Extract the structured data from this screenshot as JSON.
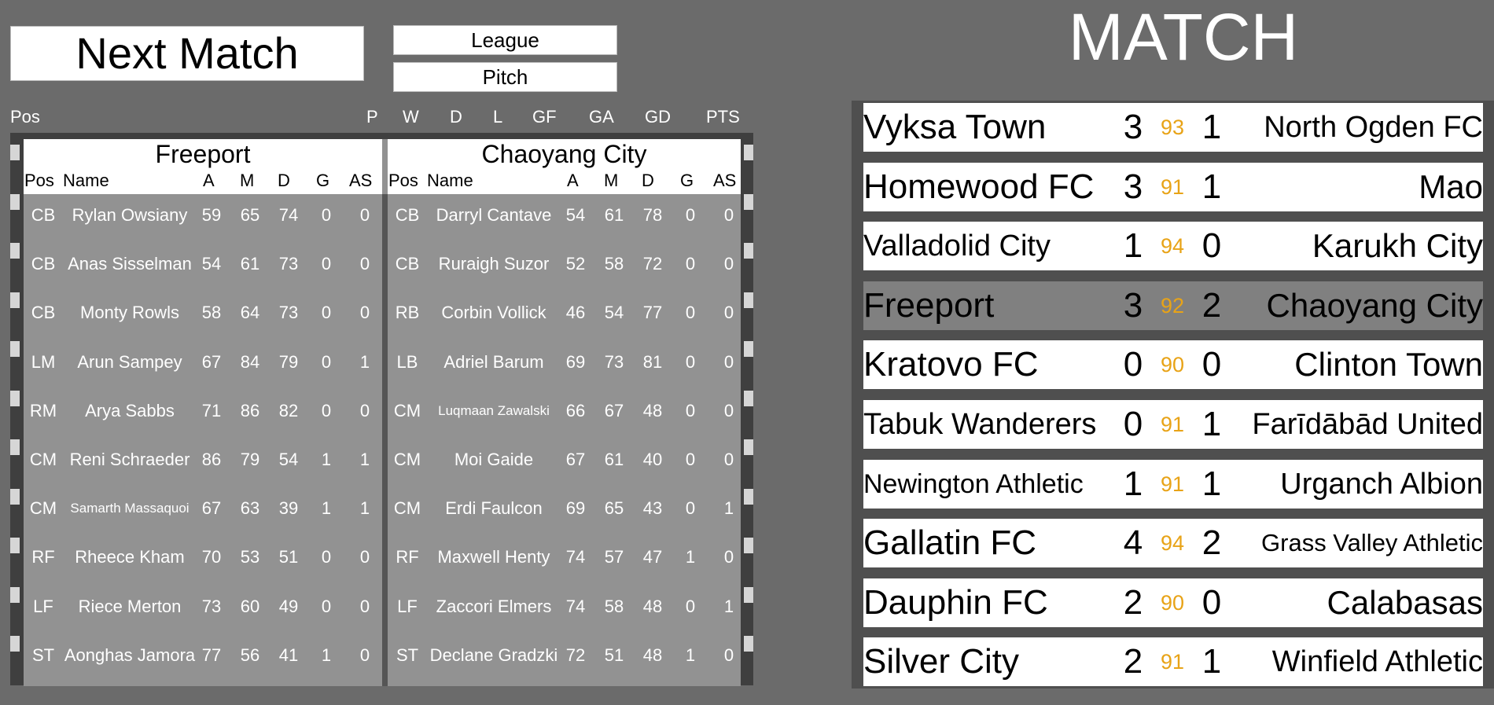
{
  "header": {
    "next_match": "Next Match",
    "league": "League",
    "pitch": "Pitch",
    "match_title": "MATCH"
  },
  "league_columns": [
    "Pos",
    "P",
    "W",
    "D",
    "L",
    "GF",
    "GA",
    "GD",
    "PTS"
  ],
  "lineups": {
    "columns": [
      "Pos",
      "Name",
      "A",
      "M",
      "D",
      "G",
      "AS"
    ],
    "home": {
      "team": "Freeport",
      "players": [
        {
          "pos": "CB",
          "name": "Rylan Owsiany",
          "a": "59",
          "m": "65",
          "d": "74",
          "g": "0",
          "as": "0"
        },
        {
          "pos": "CB",
          "name": "Anas Sisselman",
          "a": "54",
          "m": "61",
          "d": "73",
          "g": "0",
          "as": "0"
        },
        {
          "pos": "CB",
          "name": "Monty Rowls",
          "a": "58",
          "m": "64",
          "d": "73",
          "g": "0",
          "as": "0"
        },
        {
          "pos": "LM",
          "name": "Arun Sampey",
          "a": "67",
          "m": "84",
          "d": "79",
          "g": "0",
          "as": "1"
        },
        {
          "pos": "RM",
          "name": "Arya Sabbs",
          "a": "71",
          "m": "86",
          "d": "82",
          "g": "0",
          "as": "0"
        },
        {
          "pos": "CM",
          "name": "Reni Schraeder",
          "a": "86",
          "m": "79",
          "d": "54",
          "g": "1",
          "as": "1"
        },
        {
          "pos": "CM",
          "name": "Samarth Massaquoi",
          "a": "67",
          "m": "63",
          "d": "39",
          "g": "1",
          "as": "1"
        },
        {
          "pos": "RF",
          "name": "Rheece Kham",
          "a": "70",
          "m": "53",
          "d": "51",
          "g": "0",
          "as": "0"
        },
        {
          "pos": "LF",
          "name": "Riece Merton",
          "a": "73",
          "m": "60",
          "d": "49",
          "g": "0",
          "as": "0"
        },
        {
          "pos": "ST",
          "name": "Aonghas Jamora",
          "a": "77",
          "m": "56",
          "d": "41",
          "g": "1",
          "as": "0"
        }
      ]
    },
    "away": {
      "team": "Chaoyang City",
      "players": [
        {
          "pos": "CB",
          "name": "Darryl Cantave",
          "a": "54",
          "m": "61",
          "d": "78",
          "g": "0",
          "as": "0"
        },
        {
          "pos": "CB",
          "name": "Ruraigh Suzor",
          "a": "52",
          "m": "58",
          "d": "72",
          "g": "0",
          "as": "0"
        },
        {
          "pos": "RB",
          "name": "Corbin Vollick",
          "a": "46",
          "m": "54",
          "d": "77",
          "g": "0",
          "as": "0"
        },
        {
          "pos": "LB",
          "name": "Adriel Barum",
          "a": "69",
          "m": "73",
          "d": "81",
          "g": "0",
          "as": "0"
        },
        {
          "pos": "CM",
          "name": "Luqmaan Zawalski",
          "a": "66",
          "m": "67",
          "d": "48",
          "g": "0",
          "as": "0"
        },
        {
          "pos": "CM",
          "name": "Moi Gaide",
          "a": "67",
          "m": "61",
          "d": "40",
          "g": "0",
          "as": "0"
        },
        {
          "pos": "CM",
          "name": "Erdi Faulcon",
          "a": "69",
          "m": "65",
          "d": "43",
          "g": "0",
          "as": "1"
        },
        {
          "pos": "RF",
          "name": "Maxwell Henty",
          "a": "74",
          "m": "57",
          "d": "47",
          "g": "1",
          "as": "0"
        },
        {
          "pos": "LF",
          "name": "Zaccori Elmers",
          "a": "74",
          "m": "58",
          "d": "48",
          "g": "0",
          "as": "1"
        },
        {
          "pos": "ST",
          "name": "Declane Gradzki",
          "a": "72",
          "m": "51",
          "d": "48",
          "g": "1",
          "as": "0"
        }
      ]
    }
  },
  "fixtures": [
    {
      "home": "Vyksa Town",
      "home_score": "3",
      "minute": "93",
      "away_score": "1",
      "away": "North Ogden FC",
      "active": false
    },
    {
      "home": "Homewood FC",
      "home_score": "3",
      "minute": "91",
      "away_score": "1",
      "away": "Mao",
      "active": false
    },
    {
      "home": "Valladolid City",
      "home_score": "1",
      "minute": "94",
      "away_score": "0",
      "away": "Karukh City",
      "active": false
    },
    {
      "home": "Freeport",
      "home_score": "3",
      "minute": "92",
      "away_score": "2",
      "away": "Chaoyang City",
      "active": true
    },
    {
      "home": "Kratovo FC",
      "home_score": "0",
      "minute": "90",
      "away_score": "0",
      "away": "Clinton Town",
      "active": false
    },
    {
      "home": "Tabuk Wanderers",
      "home_score": "0",
      "minute": "91",
      "away_score": "1",
      "away": "Farīdābād United",
      "active": false
    },
    {
      "home": "Newington Athletic",
      "home_score": "1",
      "minute": "91",
      "away_score": "1",
      "away": "Urganch Albion",
      "active": false
    },
    {
      "home": "Gallatin FC",
      "home_score": "4",
      "minute": "94",
      "away_score": "2",
      "away": "Grass Valley Athletic",
      "active": false
    },
    {
      "home": "Dauphin FC",
      "home_score": "2",
      "minute": "90",
      "away_score": "0",
      "away": "Calabasas",
      "active": false
    },
    {
      "home": "Silver  City",
      "home_score": "2",
      "minute": "91",
      "away_score": "1",
      "away": "Winfield Athletic",
      "active": false
    }
  ],
  "colors": {
    "background": "#6b6b6b",
    "minute": "#e8a317",
    "active_fixture": "#808080"
  }
}
